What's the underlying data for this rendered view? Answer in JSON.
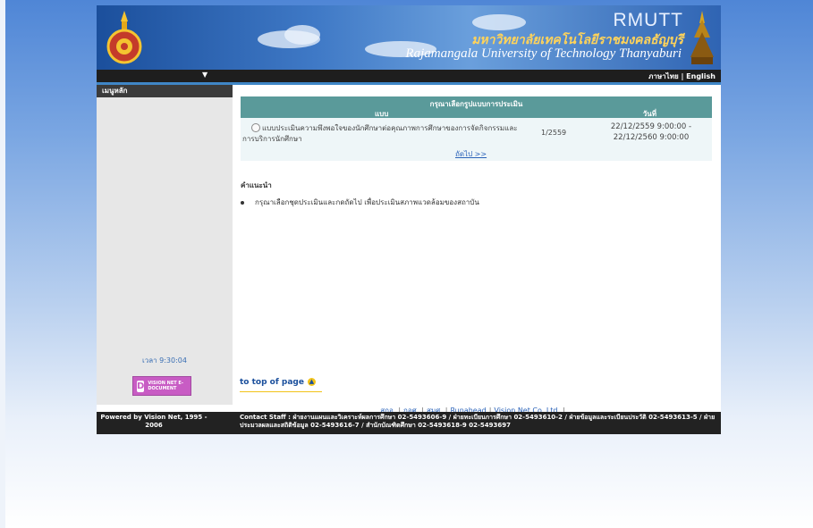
{
  "header": {
    "brand_abbr": "RMUTT",
    "thai_name": "มหาวิทยาลัยเทคโนโลยีราชมงคลธัญบุรี",
    "english_name": "Rajamangala University of Technology Thanyaburi",
    "lang_thai": "ภาษาไทย",
    "lang_sep": "|",
    "lang_english": "English",
    "dropdown_glyph": "▼"
  },
  "sidebar": {
    "menu_title": "เมนูหลัก",
    "clock": "เวลา 9:30:04",
    "badge_letter": "D",
    "badge_text": "VISION NET E-DOCUMENT"
  },
  "evaluation": {
    "prompt": "กรุณาเลือกรูปแบบการประเมิน",
    "col_form": "แบบ",
    "col_date": "วันที่",
    "rows": [
      {
        "form": "แบบประเมินความพึงพอใจของนักศึกษาต่อคุณภาพการศึกษาของการจัดกิจกรรมและการบริการนักศึกษา",
        "term": "1/2559",
        "date_start": "22/12/2559 9:00:00 -",
        "date_end": "22/12/2560 9:00:00"
      }
    ],
    "next_label": "ถัดไป >>"
  },
  "advice": {
    "heading": "คำแนะนำ",
    "items": [
      "กรุณาเลือกชุดประเมินและกดถัดไป เพื่อประเมินสภาพแวดล้อมของสถาบัน"
    ]
  },
  "to_top": "to top of page",
  "links": [
    "สกอ.",
    "กอศ.",
    "สมศ.",
    "Runahead",
    "Vision Net Co.,Ltd."
  ],
  "footer": {
    "powered": "Powered by Vision Net, 1995 - 2006",
    "contact": "Contact Staff : ฝ่ายงานแผนและวิเคราะห์ผลการศึกษา 02-5493606-9 / ฝ่ายทะเบียนการศึกษา 02-5493610-2 / ฝ่ายข้อมูลและระเบียนประวัติ 02-5493613-5 / ฝ่ายประมวลผลและสถิติข้อมูล 02-5493616-7 / สำนักบัณฑิตศึกษา 02-5493618-9 02-5493697"
  },
  "colors": {
    "table_header": "#5a9a9a",
    "sidebar_bg": "#e7e7e7",
    "footer_bg": "#222222",
    "link": "#2a62b8"
  }
}
